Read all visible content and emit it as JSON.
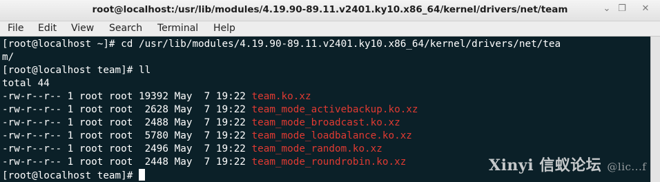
{
  "window": {
    "title": "root@localhost:/usr/lib/modules/4.19.90-89.11.v2401.ky10.x86_64/kernel/drivers/net/team",
    "minimize_glyph": "⌄",
    "maximize_glyph": "❐",
    "close_glyph": "✕"
  },
  "menu": [
    "File",
    "Edit",
    "View",
    "Search",
    "Terminal",
    "Help"
  ],
  "terminal": {
    "line1": "[root@localhost ~]# cd /usr/lib/modules/4.19.90-89.11.v2401.ky10.x86_64/kernel/drivers/net/tea",
    "line2": "m/",
    "line3": "[root@localhost team]# ll",
    "line4": "total 44",
    "files": [
      {
        "meta": "-rw-r--r-- 1 root root 19392 May  7 19:22 ",
        "name": "team.ko.xz"
      },
      {
        "meta": "-rw-r--r-- 1 root root  2628 May  7 19:22 ",
        "name": "team_mode_activebackup.ko.xz"
      },
      {
        "meta": "-rw-r--r-- 1 root root  2488 May  7 19:22 ",
        "name": "team_mode_broadcast.ko.xz"
      },
      {
        "meta": "-rw-r--r-- 1 root root  5780 May  7 19:22 ",
        "name": "team_mode_loadbalance.ko.xz"
      },
      {
        "meta": "-rw-r--r-- 1 root root  2496 May  7 19:22 ",
        "name": "team_mode_random.ko.xz"
      },
      {
        "meta": "-rw-r--r-- 1 root root  2448 May  7 19:22 ",
        "name": "team_mode_roundrobin.ko.xz"
      }
    ],
    "prompt": "[root@localhost team]# "
  },
  "watermark": {
    "main": "Xinyi 信蚁论坛",
    "sub": "@lic...f"
  },
  "colors": {
    "terminal_bg": "#0b2028",
    "terminal_fg": "#ffffff",
    "filename": "#e03a32"
  }
}
